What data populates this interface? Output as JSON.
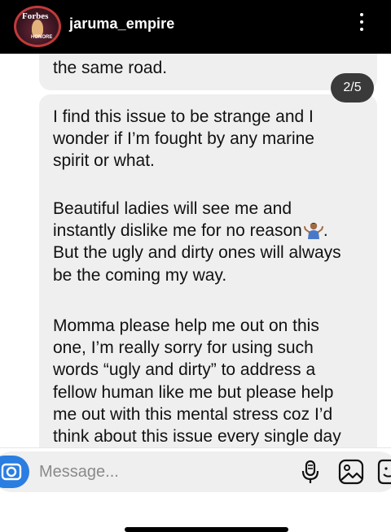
{
  "header": {
    "username": "jaruma_empire",
    "avatar": {
      "magazine_text": "Forbes",
      "badge_text": "HONORE"
    }
  },
  "thread": {
    "previous_bubble_tail": "the same road.",
    "page_indicator": "2/5",
    "message": {
      "lines_p1": [
        "I find this issue to be strange and I",
        "wonder if I’m fought by any marine",
        "spirit or what."
      ],
      "p2_line1": "Beautiful ladies will see me and",
      "p2_line2_before_emoji": "instantly dislike me for no reason",
      "p2_line2_after_emoji": ".",
      "p2_emoji_icon": "person-shrugging-emoji",
      "lines_p2_rest": [
        "But the ugly and dirty ones will always",
        "be the coming my way."
      ],
      "lines_p3": [
        "Momma please help me out on this",
        "one, I’m really sorry for using such",
        "words “ugly and dirty” to address a",
        "fellow human like me but please help",
        "me out with this mental stress coz I’d",
        "think about this issue every single day"
      ]
    }
  },
  "composer": {
    "placeholder": "Message...",
    "icons": [
      "camera-icon",
      "microphone-icon",
      "gallery-icon",
      "sticker-icon"
    ]
  },
  "colors": {
    "header_bg": "#000000",
    "bubble_bg": "#efefef",
    "badge_bg": "#3a3a3a",
    "camera_blue": "#2a7de1"
  }
}
